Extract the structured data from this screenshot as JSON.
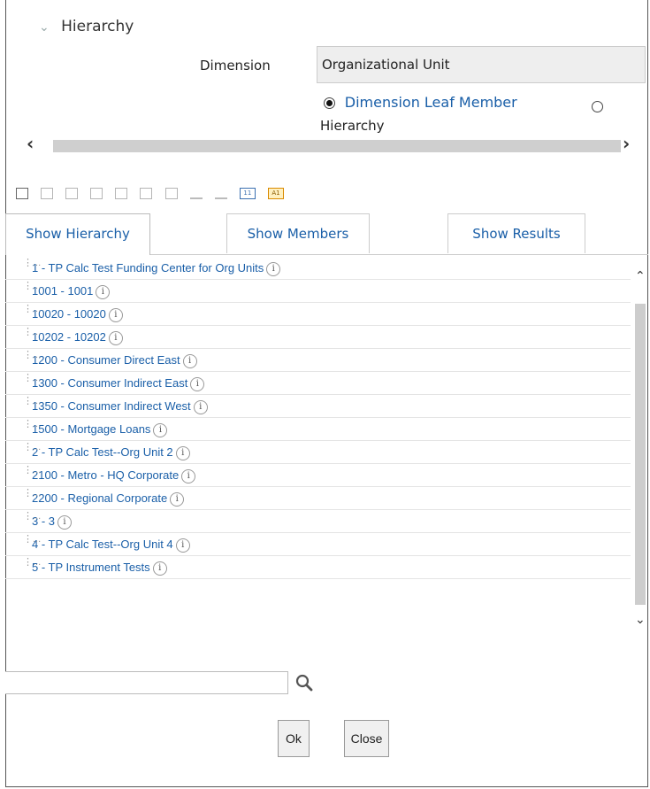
{
  "section": {
    "title": "Hierarchy"
  },
  "dimension": {
    "label": "Dimension",
    "value": "Organizational Unit"
  },
  "radio": {
    "option1": "Dimension Leaf Member",
    "option2": "Hierarchy"
  },
  "tabs": [
    {
      "label": "Show Hierarchy"
    },
    {
      "label": "Show Members"
    },
    {
      "label": "Show Results"
    }
  ],
  "toolbar": {
    "num_label": "11",
    "abc_label": "A1"
  },
  "info_glyph": "i",
  "rows": [
    {
      "text": "1 - TP Calc Test Funding Center for Org Units"
    },
    {
      "text": "1001 - 1001"
    },
    {
      "text": "10020 - 10020"
    },
    {
      "text": "10202 - 10202"
    },
    {
      "text": "1200 - Consumer Direct East"
    },
    {
      "text": "1300 - Consumer Indirect East"
    },
    {
      "text": "1350 - Consumer Indirect  West"
    },
    {
      "text": "1500 - Mortgage Loans"
    },
    {
      "text": "2 - TP Calc Test--Org Unit 2"
    },
    {
      "text": "2100 - Metro - HQ Corporate"
    },
    {
      "text": "2200 - Regional Corporate"
    },
    {
      "text": "3 - 3"
    },
    {
      "text": "4 - TP Calc Test--Org Unit 4"
    },
    {
      "text": "5 - TP Instrument Tests"
    }
  ],
  "buttons": {
    "ok": "Ok",
    "close": "Close"
  }
}
